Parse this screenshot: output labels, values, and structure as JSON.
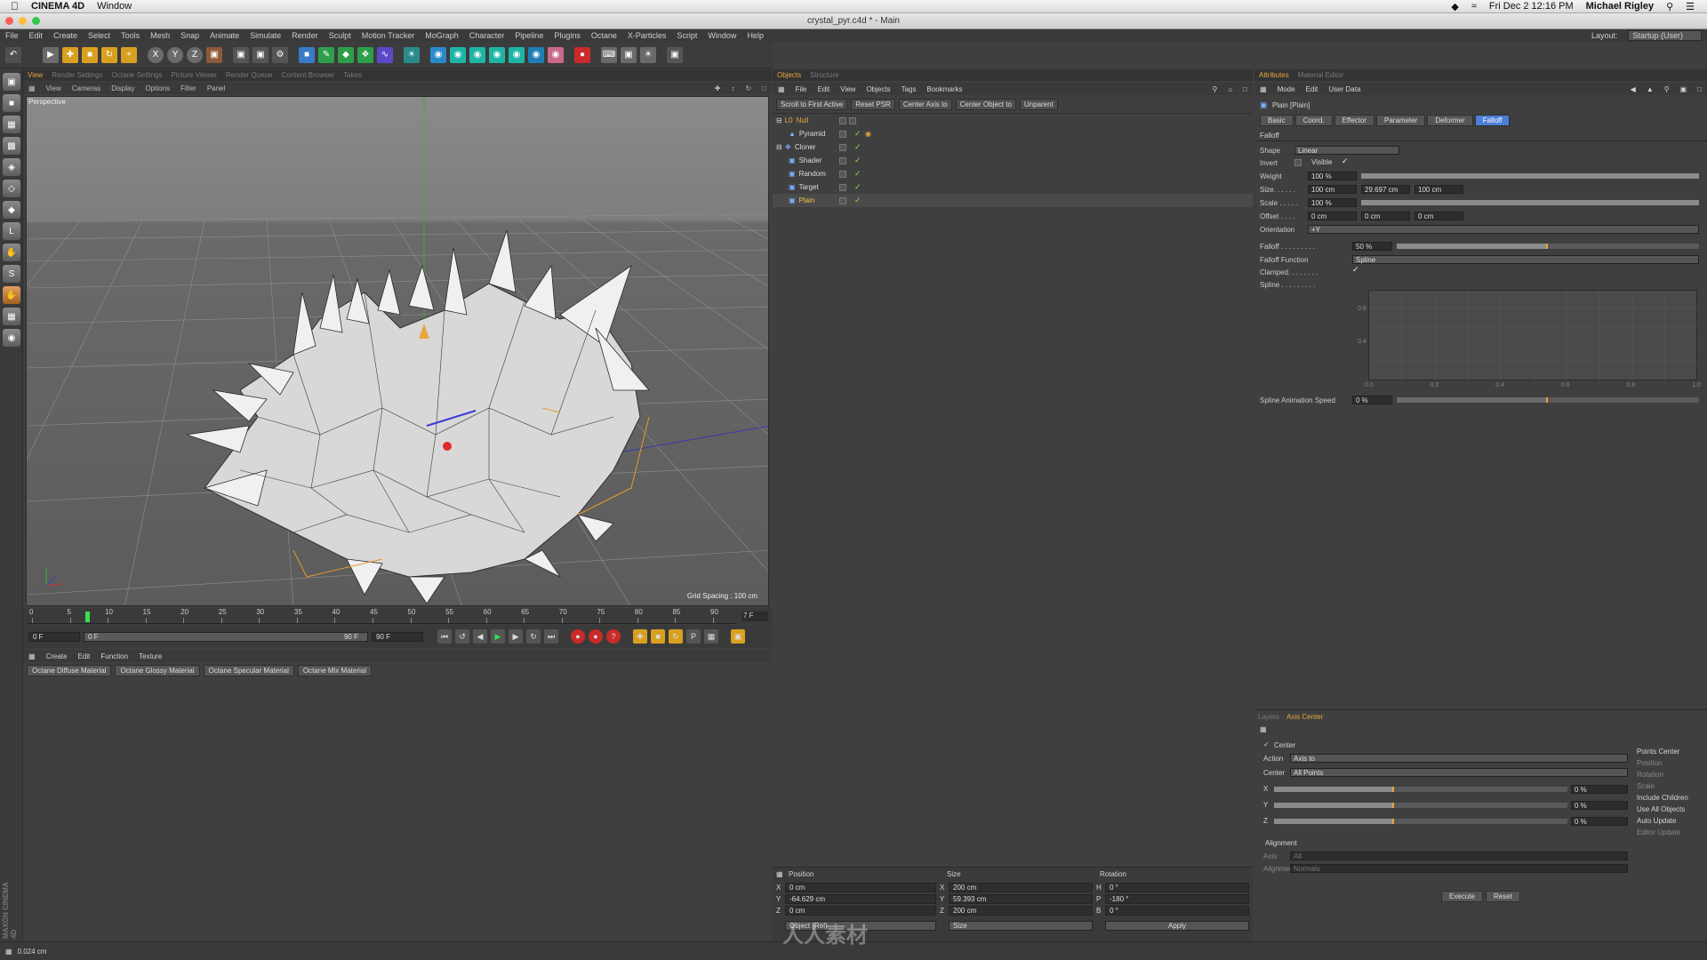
{
  "macbar": {
    "app": "CINEMA 4D",
    "menu": "Window",
    "clock": "Fri Dec 2  12:16 PM",
    "user": "Michael Rigley"
  },
  "window": {
    "title": "crystal_pyr.c4d * - Main"
  },
  "menu": [
    "File",
    "Edit",
    "Create",
    "Select",
    "Tools",
    "Mesh",
    "Snap",
    "Animate",
    "Simulate",
    "Render",
    "Sculpt",
    "Motion Tracker",
    "MoGraph",
    "Character",
    "Pipeline",
    "Plugins",
    "Octane",
    "X-Particles",
    "Script",
    "Window",
    "Help"
  ],
  "layout": {
    "label": "Layout:",
    "value": "Startup (User)"
  },
  "viewport": {
    "tabs": [
      "View",
      "Render Settings",
      "Octane Settings",
      "Picture Viewer",
      "Render Queue",
      "Content Browser",
      "Takes"
    ],
    "menu": [
      "View",
      "Cameras",
      "Display",
      "Options",
      "Filter",
      "Panel"
    ],
    "label": "Perspective",
    "grid": "Grid Spacing : 100 cm"
  },
  "timeline": {
    "ticks": [
      "0",
      "5",
      "10",
      "15",
      "20",
      "25",
      "30",
      "35",
      "40",
      "45",
      "50",
      "55",
      "60",
      "65",
      "70",
      "75",
      "80",
      "85",
      "90"
    ],
    "current": "7 F",
    "start": "0 F",
    "range_start": "0 F",
    "range_end": "90 F",
    "end": "90 F",
    "current_fraction": 0.078
  },
  "material": {
    "menu": [
      "Create",
      "Edit",
      "Function",
      "Texture"
    ],
    "buttons": [
      "Octane Diffuse Material",
      "Octane Glossy Material",
      "Octane Specular Material",
      "Octane Mix Material"
    ]
  },
  "objects": {
    "tabs": [
      "Objects",
      "Structure"
    ],
    "menu": [
      "File",
      "Edit",
      "View",
      "Objects",
      "Tags",
      "Bookmarks"
    ],
    "buttons": [
      "Scroll to First Active",
      "Reset PSR",
      "Center Axis to",
      "Center Object to",
      "Unparent"
    ],
    "items": [
      {
        "name": "Null",
        "color": "#e8a640"
      },
      {
        "name": "Pyramid",
        "color": "#dddddd"
      },
      {
        "name": "Cloner",
        "color": "#dddddd"
      },
      {
        "name": "Shader",
        "color": "#dddddd"
      },
      {
        "name": "Random",
        "color": "#dddddd"
      },
      {
        "name": "Target",
        "color": "#dddddd"
      },
      {
        "name": "Plain",
        "color": "#f1c34a"
      }
    ]
  },
  "coords": {
    "headers": [
      "Position",
      "Size",
      "Rotation"
    ],
    "pos": [
      {
        "axis": "X",
        "v": "0 cm"
      },
      {
        "axis": "Y",
        "v": "-64.629 cm"
      },
      {
        "axis": "Z",
        "v": "0 cm"
      }
    ],
    "size": [
      {
        "axis": "X",
        "v": "200 cm"
      },
      {
        "axis": "Y",
        "v": "59.393 cm"
      },
      {
        "axis": "Z",
        "v": "200 cm"
      }
    ],
    "rot": [
      {
        "axis": "H",
        "v": "0 °"
      },
      {
        "axis": "P",
        "v": "-180 °"
      },
      {
        "axis": "B",
        "v": "0 °"
      }
    ],
    "mode": "Object (Rel)",
    "size_mode": "Size",
    "apply": "Apply"
  },
  "attributes": {
    "tabs": [
      "Attributes",
      "Material Editor"
    ],
    "menu": [
      "Mode",
      "Edit",
      "User Data"
    ],
    "object": "Plain [Plain]",
    "subtabs": [
      "Basic",
      "Coord.",
      "Effector",
      "Parameter",
      "Deformer",
      "Falloff"
    ],
    "section": "Falloff",
    "shape_label": "Shape",
    "shape": "Linear",
    "invert": "Invert",
    "visible": "Visible",
    "weight_label": "Weight",
    "weight": "100 %",
    "size_label": "Size. . . . . .",
    "size": [
      "100 cm",
      "29.697 cm",
      "100 cm"
    ],
    "scale_label": "Scale . . . . .",
    "scale": "100 %",
    "offset_label": "Offset . . . .",
    "offset": [
      "0 cm",
      "0 cm",
      "0 cm"
    ],
    "orientation_label": "Orientation",
    "orientation": "+Y",
    "falloff_label": "Falloff . . . . . . . . .",
    "falloff": "50 %",
    "falloff_fn_label": "Falloff Function",
    "falloff_fn": "Spline",
    "clamped_label": "Clamped. . . . . . . .",
    "spline_label": "Spline . . . . . . . . .",
    "graph_y": [
      "0.8",
      "0.4"
    ],
    "graph_x": [
      "0.0",
      "0.2",
      "0.4",
      "0.6",
      "0.8",
      "1.0"
    ],
    "spline_speed_label": "Spline Animation Speed",
    "spline_speed": "0 %"
  },
  "layers": {
    "tabs": [
      "Layers",
      "Axis Center"
    ],
    "center": "Center",
    "action_label": "Action",
    "action": "Axis to",
    "center_label": "Center",
    "center_value": "All Points",
    "axes": [
      {
        "axis": "X",
        "v": "0 %"
      },
      {
        "axis": "Y",
        "v": "0 %"
      },
      {
        "axis": "Z",
        "v": "0 %"
      }
    ],
    "right": [
      "Points Center",
      "Position",
      "Rotation",
      "Scale",
      "Include Children",
      "Use All Objects",
      "Auto Update",
      "Editor Update"
    ],
    "alignment": "Alignment",
    "axis_label": "Axis",
    "axis_value": "All",
    "alignment_label": "Alignment",
    "alignment_value": "Normals",
    "execute": "Execute",
    "reset": "Reset"
  },
  "status": {
    "text": "0.024 cm",
    "brand": "MAXON CINEMA 4D"
  },
  "watermark": "人人素材"
}
